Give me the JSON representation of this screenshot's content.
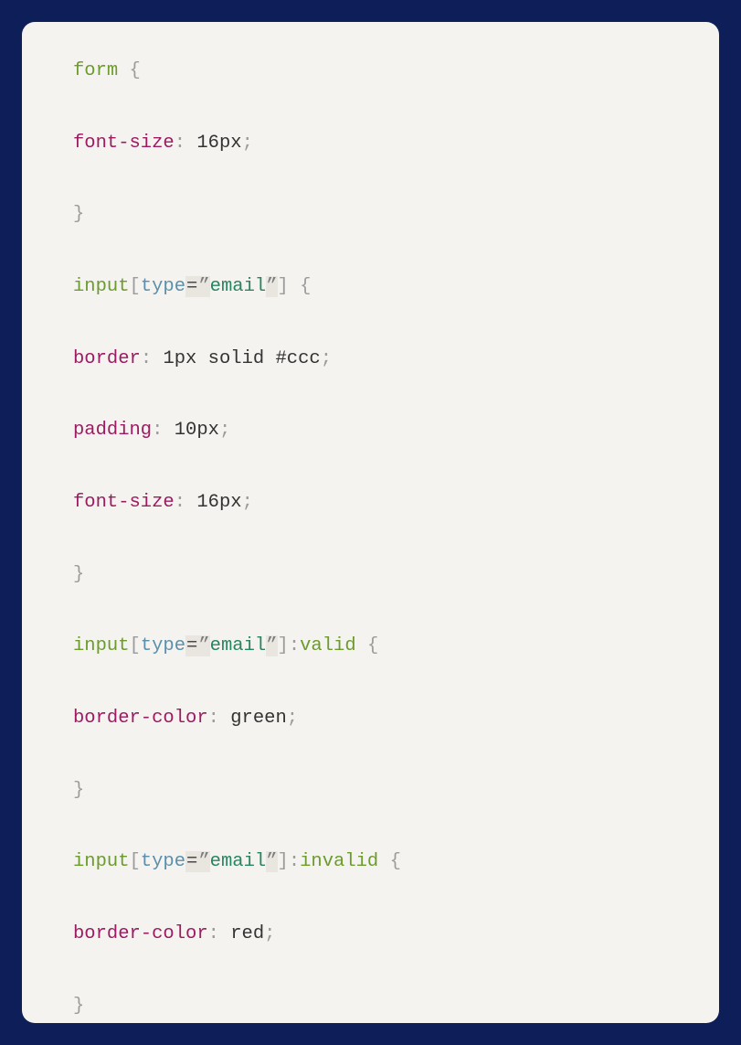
{
  "code": {
    "rules": [
      {
        "selector": {
          "parts": [
            {
              "t": "tag",
              "v": "form"
            }
          ]
        },
        "decls": [
          {
            "prop": "font-size",
            "value": [
              {
                "t": "num",
                "v": "16"
              },
              {
                "t": "unit",
                "v": "px"
              }
            ]
          }
        ]
      },
      {
        "selector": {
          "parts": [
            {
              "t": "tag",
              "v": "input"
            },
            {
              "t": "punc",
              "v": "["
            },
            {
              "t": "attr",
              "v": "type"
            },
            {
              "t": "eq",
              "v": "="
            },
            {
              "t": "quote",
              "v": "”"
            },
            {
              "t": "str",
              "v": "email"
            },
            {
              "t": "quote",
              "v": "”"
            },
            {
              "t": "punc",
              "v": "]"
            }
          ]
        },
        "decls": [
          {
            "prop": "border",
            "value": [
              {
                "t": "num",
                "v": "1"
              },
              {
                "t": "unit",
                "v": "px"
              },
              {
                "t": "sp",
                "v": " "
              },
              {
                "t": "kw",
                "v": "solid"
              },
              {
                "t": "sp",
                "v": " "
              },
              {
                "t": "hash",
                "v": "#ccc"
              }
            ]
          },
          {
            "prop": "padding",
            "value": [
              {
                "t": "num",
                "v": "10"
              },
              {
                "t": "unit",
                "v": "px"
              }
            ]
          },
          {
            "prop": "font-size",
            "value": [
              {
                "t": "num",
                "v": "16"
              },
              {
                "t": "unit",
                "v": "px"
              }
            ]
          }
        ]
      },
      {
        "selector": {
          "parts": [
            {
              "t": "tag",
              "v": "input"
            },
            {
              "t": "punc",
              "v": "["
            },
            {
              "t": "attr",
              "v": "type"
            },
            {
              "t": "eq",
              "v": "="
            },
            {
              "t": "quote",
              "v": "”"
            },
            {
              "t": "str",
              "v": "email"
            },
            {
              "t": "quote",
              "v": "”"
            },
            {
              "t": "punc",
              "v": "]"
            },
            {
              "t": "punc",
              "v": ":"
            },
            {
              "t": "tag",
              "v": "valid"
            }
          ]
        },
        "decls": [
          {
            "prop": "border-color",
            "value": [
              {
                "t": "kw",
                "v": "green"
              }
            ]
          }
        ]
      },
      {
        "selector": {
          "parts": [
            {
              "t": "tag",
              "v": "input"
            },
            {
              "t": "punc",
              "v": "["
            },
            {
              "t": "attr",
              "v": "type"
            },
            {
              "t": "eq",
              "v": "="
            },
            {
              "t": "quote",
              "v": "”"
            },
            {
              "t": "str",
              "v": "email"
            },
            {
              "t": "quote",
              "v": "”"
            },
            {
              "t": "punc",
              "v": "]"
            },
            {
              "t": "punc",
              "v": ":"
            },
            {
              "t": "tag",
              "v": "invalid"
            }
          ]
        },
        "decls": [
          {
            "prop": "border-color",
            "value": [
              {
                "t": "kw",
                "v": "red"
              }
            ]
          }
        ]
      }
    ]
  }
}
